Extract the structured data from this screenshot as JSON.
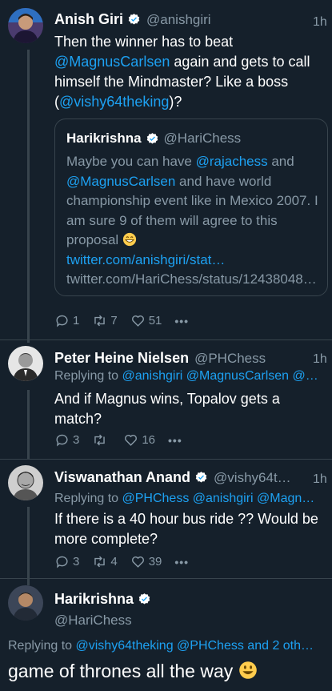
{
  "tweets": [
    {
      "name": "Anish Giri",
      "handle": "@anishgiri",
      "time": "1h",
      "verified": true,
      "text_1": "Then the winner has to beat",
      "mention_1": "@MagnusCarlsen",
      "text_2": " again and gets to call himself the Mindmaster? Like a boss (",
      "mention_2": "@vishy64theking",
      "text_3": ")?",
      "quote": {
        "name": "Harikrishna",
        "handle": "@HariChess",
        "verified": true,
        "text_1": "Maybe you can have ",
        "mention_1": "@rajachess",
        "text_2": " and ",
        "mention_2": "@MagnusCarlsen",
        "text_3": " and have world championship event like in Mexico 2007. I am sure 9 of them will agree to this proposal ",
        "emoji": "grinning-face",
        "link": "twitter.com/anishgiri/stat…",
        "source_link": "twitter.com/HariChess/status/12438048…"
      },
      "replies": "1",
      "retweets": "7",
      "likes": "51",
      "more": "•••"
    },
    {
      "name": "Peter Heine Nielsen",
      "handle": "@PHChess",
      "time": "1h",
      "verified": false,
      "replying_label": "Replying to ",
      "replying_to": "@anishgiri @MagnusCarlsen @…",
      "text": "And if Magnus wins, Topalov gets a match?",
      "replies": "3",
      "retweets": "",
      "likes": "16",
      "more": "•••"
    },
    {
      "name": "Viswanathan Anand",
      "handle": "@vishy64t…",
      "time": "1h",
      "verified": true,
      "replying_label": "Replying to ",
      "replying_to": "@PHChess @anishgiri @Magn…",
      "text": "If there is a 40 hour bus ride ?? Would be more complete?",
      "replies": "3",
      "retweets": "4",
      "likes": "39",
      "more": "•••"
    },
    {
      "name": "Harikrishna",
      "handle": "@HariChess",
      "verified": true,
      "replying_label": "Replying to ",
      "replying_to": "@vishy64theking @PHChess and 2 oth…",
      "text": "game of thrones all the way ",
      "emoji": "smiling-face"
    }
  ],
  "colors": {
    "background": "#15202b",
    "accent": "#1da1f2",
    "muted": "#8899a6",
    "border": "#38444d",
    "like": "#8899a6"
  }
}
